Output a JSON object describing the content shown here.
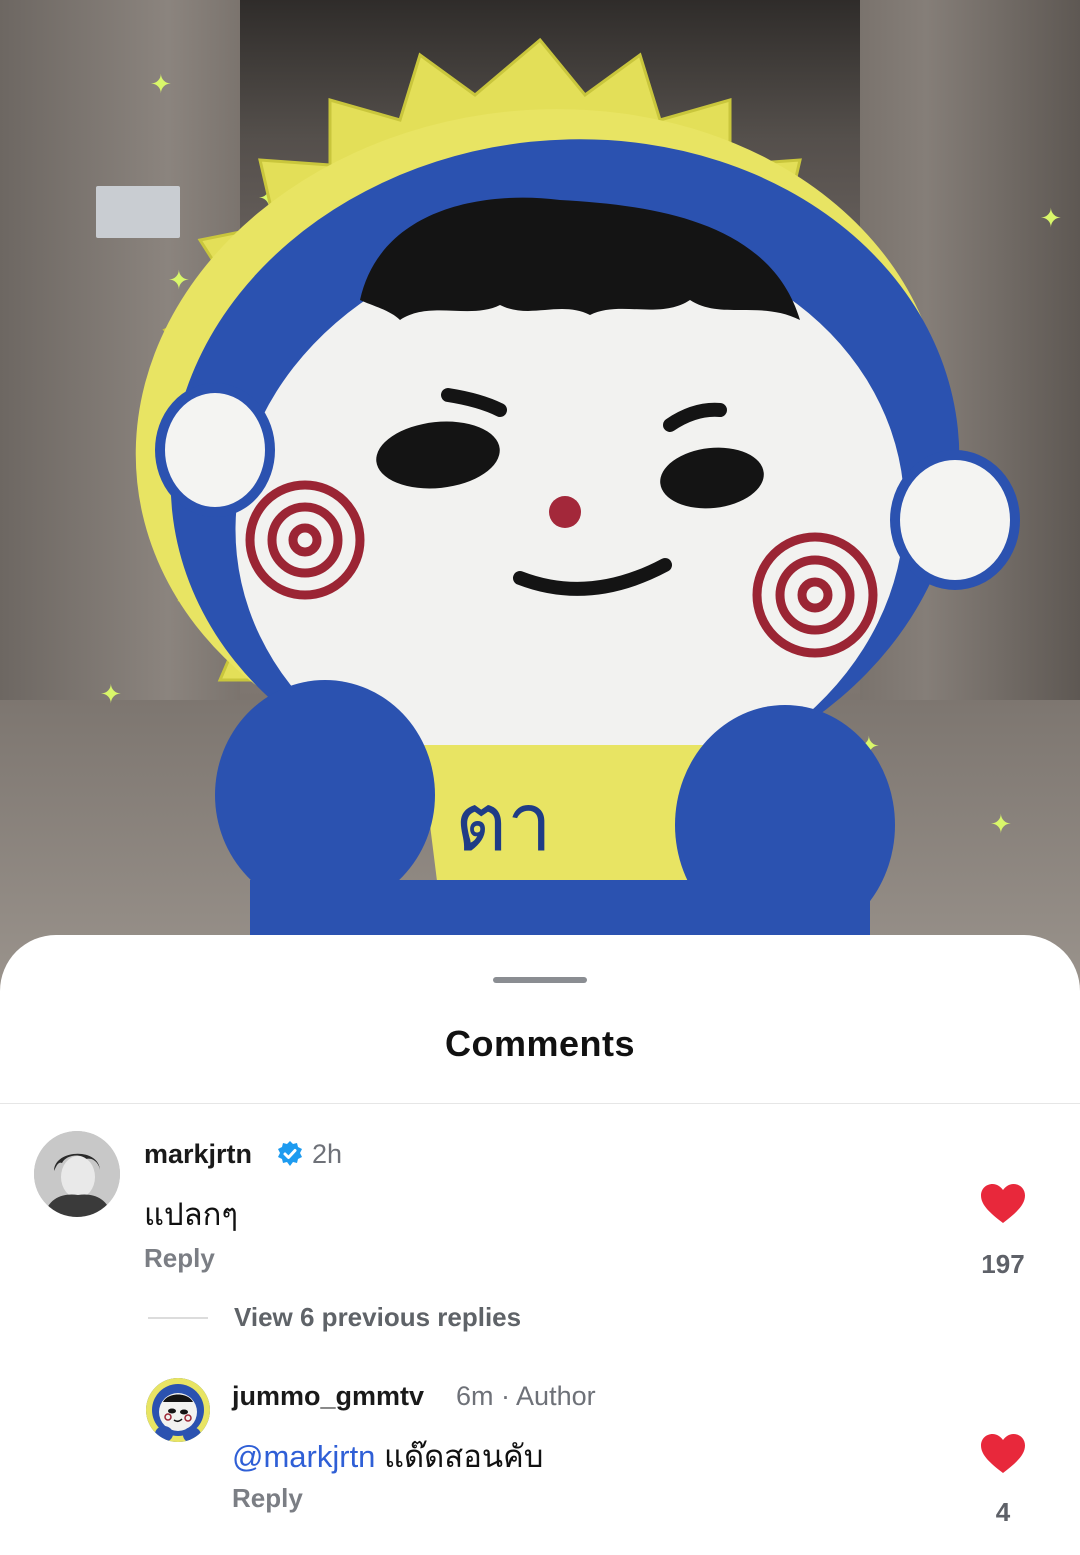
{
  "sheet": {
    "title": "Comments"
  },
  "comments": [
    {
      "username": "markjrtn",
      "verified": true,
      "time": "2h",
      "text": "แปลกๆ",
      "reply_label": "Reply",
      "likes": "197",
      "avatar_icon": "profile-photo-icon"
    }
  ],
  "view_replies": "View 6 previous replies",
  "replies": [
    {
      "username": "jummo_gmmtv",
      "time": "6m",
      "separator": "·",
      "badge": "Author",
      "mention": "@markjrtn",
      "text": "แด๊ดสอนคับ",
      "reply_label": "Reply",
      "likes": "4",
      "avatar_icon": "mascot-avatar-icon"
    }
  ],
  "colors": {
    "heart": "#e8283b",
    "verified": "#1d9bf0",
    "mention": "#2f5fd6",
    "mascot_blue": "#2b52b0",
    "mascot_yellow": "#e6e25a"
  },
  "mascot_shirt_text": "ตา"
}
